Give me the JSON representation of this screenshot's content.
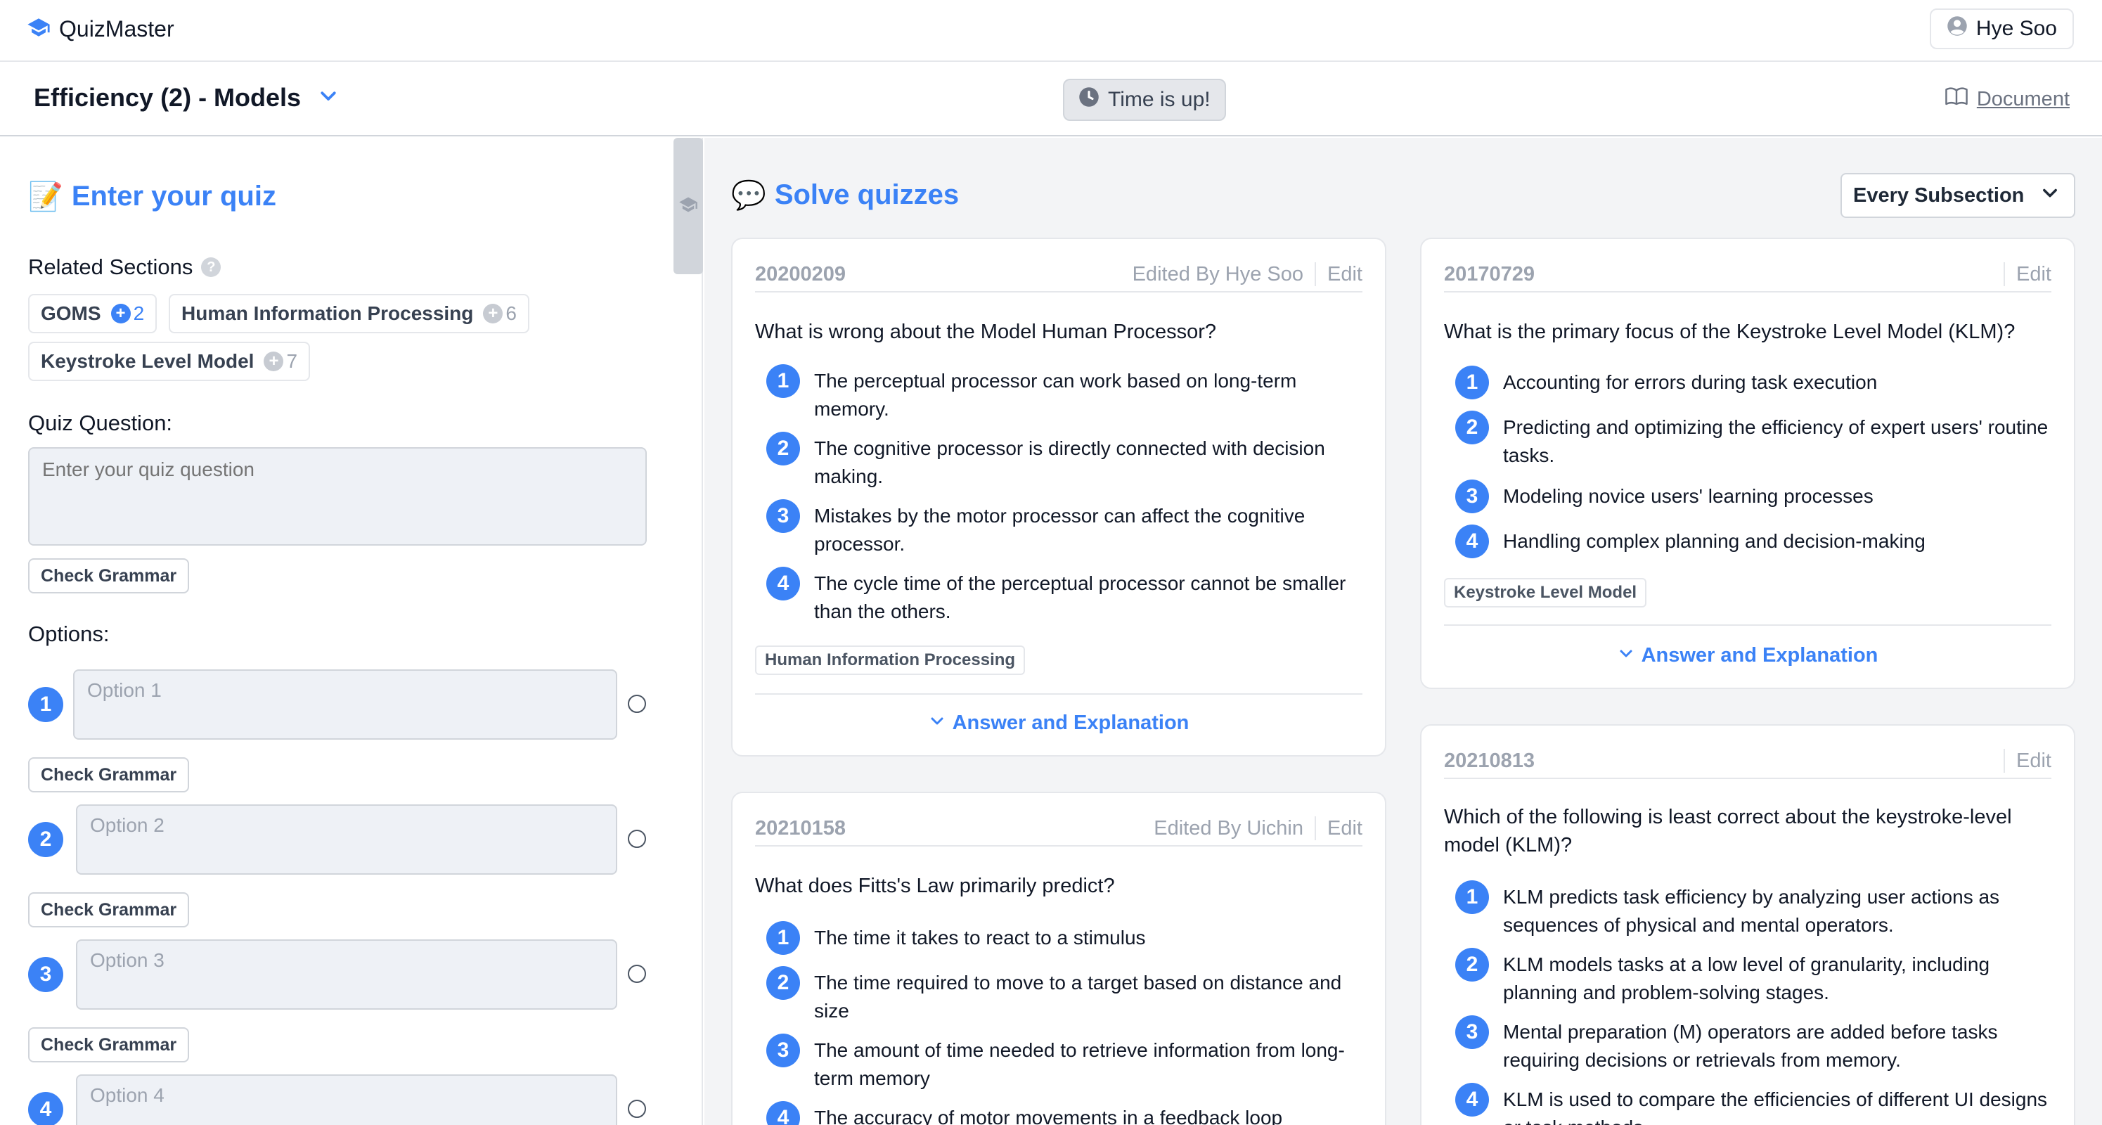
{
  "app": {
    "name": "QuizMaster",
    "user": "Hye Soo"
  },
  "header": {
    "title": "Efficiency (2) - Models",
    "timer": "Time is up!",
    "doc_link": "Document"
  },
  "left": {
    "heading": "Enter your quiz",
    "heading_icon": "📝",
    "related_label": "Related Sections",
    "chips": [
      {
        "name": "GOMS",
        "count": "2"
      },
      {
        "name": "Human Information Processing",
        "count": "6"
      },
      {
        "name": "Keystroke Level Model",
        "count": "7"
      }
    ],
    "question_label": "Quiz Question:",
    "question_placeholder": "Enter your quiz question",
    "check_grammar": "Check Grammar",
    "options_label": "Options:",
    "options": [
      {
        "num": "1",
        "placeholder": "Option 1"
      },
      {
        "num": "2",
        "placeholder": "Option 2"
      },
      {
        "num": "3",
        "placeholder": "Option 3"
      },
      {
        "num": "4",
        "placeholder": "Option 4"
      }
    ]
  },
  "right": {
    "heading": "Solve quizzes",
    "heading_icon": "💬",
    "filter": "Every Subsection",
    "edit_label": "Edit",
    "answer_label": "Answer and Explanation",
    "cards": [
      {
        "id": "20200209",
        "edited_by": "Edited By Hye Soo",
        "question": "What is wrong about the Model Human Processor?",
        "options": [
          "The perceptual processor can work based on long-term memory.",
          "The cognitive processor is directly connected with decision making.",
          "Mistakes by the motor processor can affect the cognitive processor.",
          "The cycle time of the perceptual processor cannot be smaller than the others."
        ],
        "tag": "Human Information Processing"
      },
      {
        "id": "20170729",
        "edited_by": "",
        "question": "What is the primary focus of the Keystroke Level Model (KLM)?",
        "options": [
          "Accounting for errors during task execution",
          "Predicting and optimizing the efficiency of expert users' routine tasks.",
          "Modeling novice users' learning processes",
          "Handling complex planning and decision-making"
        ],
        "tag": "Keystroke Level Model"
      },
      {
        "id": "20210158",
        "edited_by": "Edited By Uichin",
        "question": "What does Fitts's Law primarily predict?",
        "options": [
          "The time it takes to react to a stimulus",
          "The time required to move to a target based on distance and size",
          "The amount of time needed to retrieve information from long-term memory",
          "The accuracy of motor movements in a feedback loop"
        ]
      },
      {
        "id": "20210813",
        "edited_by": "",
        "question": "Which of the following is least correct about the keystroke-level model (KLM)?",
        "options": [
          "KLM predicts task efficiency by analyzing user actions as sequences of physical and mental operators.",
          "KLM models tasks at a low level of granularity, including planning and problem-solving stages.",
          "Mental preparation (M) operators are added before tasks requiring decisions or retrievals from memory.",
          "KLM is used to compare the efficiencies of different UI designs or task methods."
        ]
      }
    ]
  }
}
